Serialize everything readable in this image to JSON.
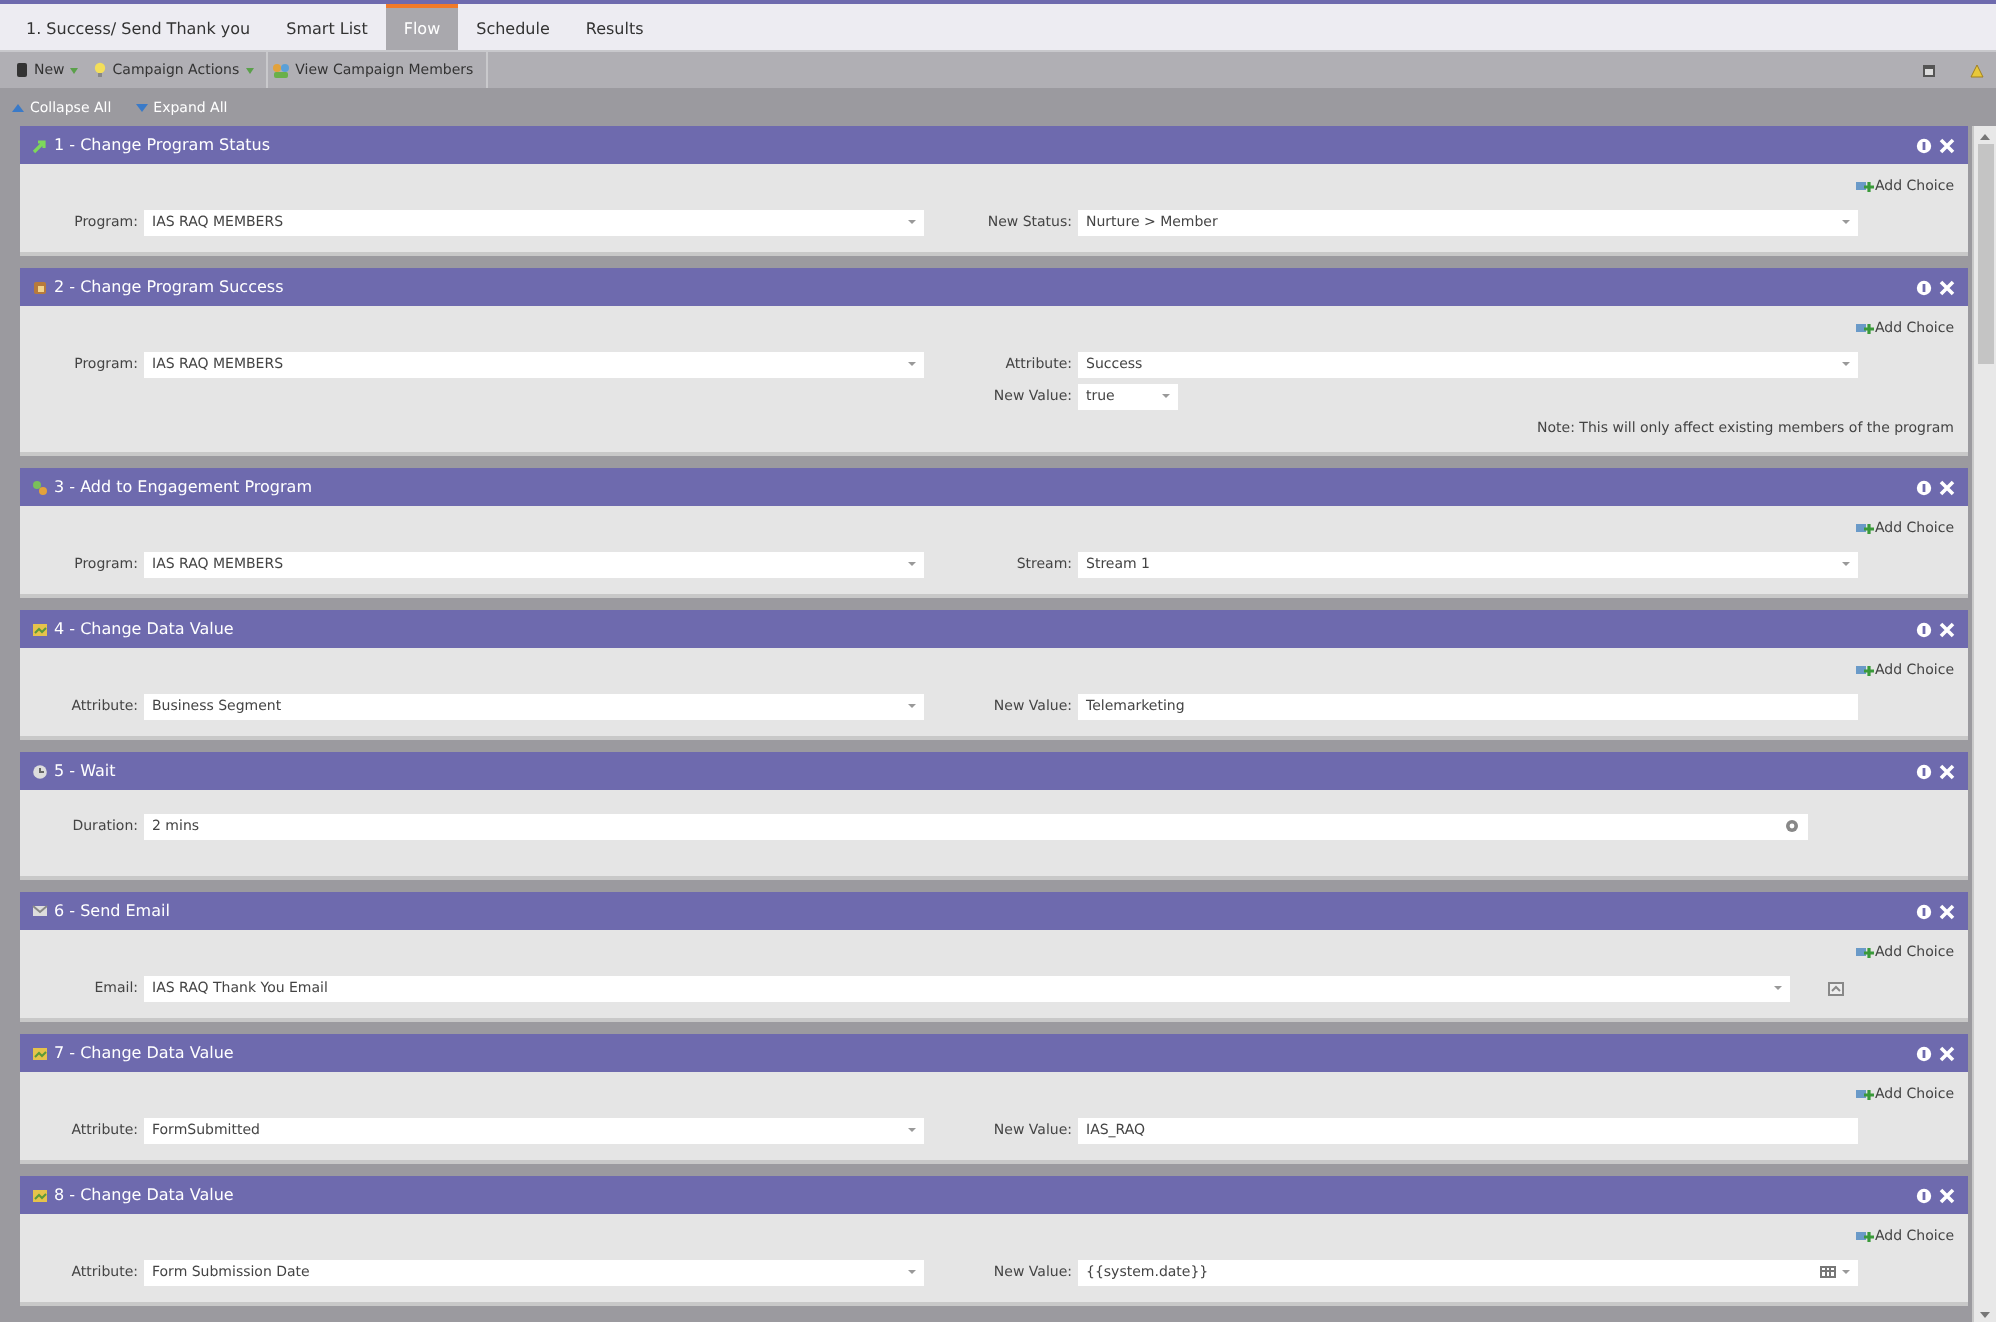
{
  "tabs": [
    {
      "label": "1. Success/ Send Thank you",
      "selected": false
    },
    {
      "label": "Smart List",
      "selected": false
    },
    {
      "label": "Flow",
      "selected": true
    },
    {
      "label": "Schedule",
      "selected": false
    },
    {
      "label": "Results",
      "selected": false
    }
  ],
  "toolbar": [
    {
      "label": "New",
      "kind": "phone",
      "menu": true
    },
    {
      "label": "Campaign Actions",
      "kind": "bulb",
      "menu": true
    },
    {
      "label": "View Campaign Members",
      "kind": "people",
      "menu": false
    }
  ],
  "subbar": [
    {
      "label": "Collapse All",
      "kind": "collapse"
    },
    {
      "label": "Expand All",
      "kind": "expand"
    }
  ],
  "steps": [
    {
      "title": "1 - Change Program Status",
      "kind": "status",
      "add_choice": "Add Choice",
      "columns": [
        [
          {
            "label": "Program:",
            "value": "IAS RAQ MEMBERS",
            "kind": "select"
          }
        ],
        [
          {
            "label": "New Status:",
            "value": "Nurture > Member",
            "kind": "select"
          }
        ]
      ]
    },
    {
      "title": "2 - Change Program Success",
      "kind": "success",
      "add_choice": "Add Choice",
      "columns": [
        [
          {
            "label": "Program:",
            "value": "IAS RAQ MEMBERS",
            "kind": "select"
          }
        ],
        [
          {
            "label": "Attribute:",
            "value": "Success",
            "kind": "select"
          },
          {
            "label": "New Value:",
            "value": "true",
            "kind": "small_select"
          }
        ]
      ],
      "note": "Note: This will only affect existing members of the program"
    },
    {
      "title": "3 - Add to Engagement Program",
      "kind": "engagement",
      "add_choice": "Add Choice",
      "columns": [
        [
          {
            "label": "Program:",
            "value": "IAS RAQ MEMBERS",
            "kind": "select"
          }
        ],
        [
          {
            "label": "Stream:",
            "value": "Stream 1",
            "kind": "select"
          }
        ]
      ]
    },
    {
      "title": "4 - Change Data Value",
      "kind": "data",
      "add_choice": "Add Choice",
      "columns": [
        [
          {
            "label": "Attribute:",
            "value": "Business Segment",
            "kind": "select"
          }
        ],
        [
          {
            "label": "New Value:",
            "value": "Telemarketing",
            "kind": "text"
          }
        ]
      ]
    },
    {
      "title": "5 - Wait",
      "kind": "wait",
      "columns": [
        [
          {
            "label": "Duration:",
            "value": "2 mins",
            "kind": "duration"
          }
        ]
      ]
    },
    {
      "title": "6 - Send Email",
      "kind": "email",
      "add_choice": "Add Choice",
      "columns": [
        [
          {
            "label": "Email:",
            "value": "IAS RAQ Thank You Email",
            "kind": "email"
          }
        ]
      ]
    },
    {
      "title": "7 - Change Data Value",
      "kind": "data",
      "add_choice": "Add Choice",
      "columns": [
        [
          {
            "label": "Attribute:",
            "value": "FormSubmitted",
            "kind": "select"
          }
        ],
        [
          {
            "label": "New Value:",
            "value": "IAS_RAQ",
            "kind": "text"
          }
        ]
      ]
    },
    {
      "title": "8 - Change Data Value",
      "kind": "data",
      "add_choice": "Add Choice",
      "columns": [
        [
          {
            "label": "Attribute:",
            "value": "Form Submission Date",
            "kind": "select"
          }
        ],
        [
          {
            "label": "New Value:",
            "value": "{{system.date}}",
            "kind": "date"
          }
        ]
      ]
    }
  ]
}
